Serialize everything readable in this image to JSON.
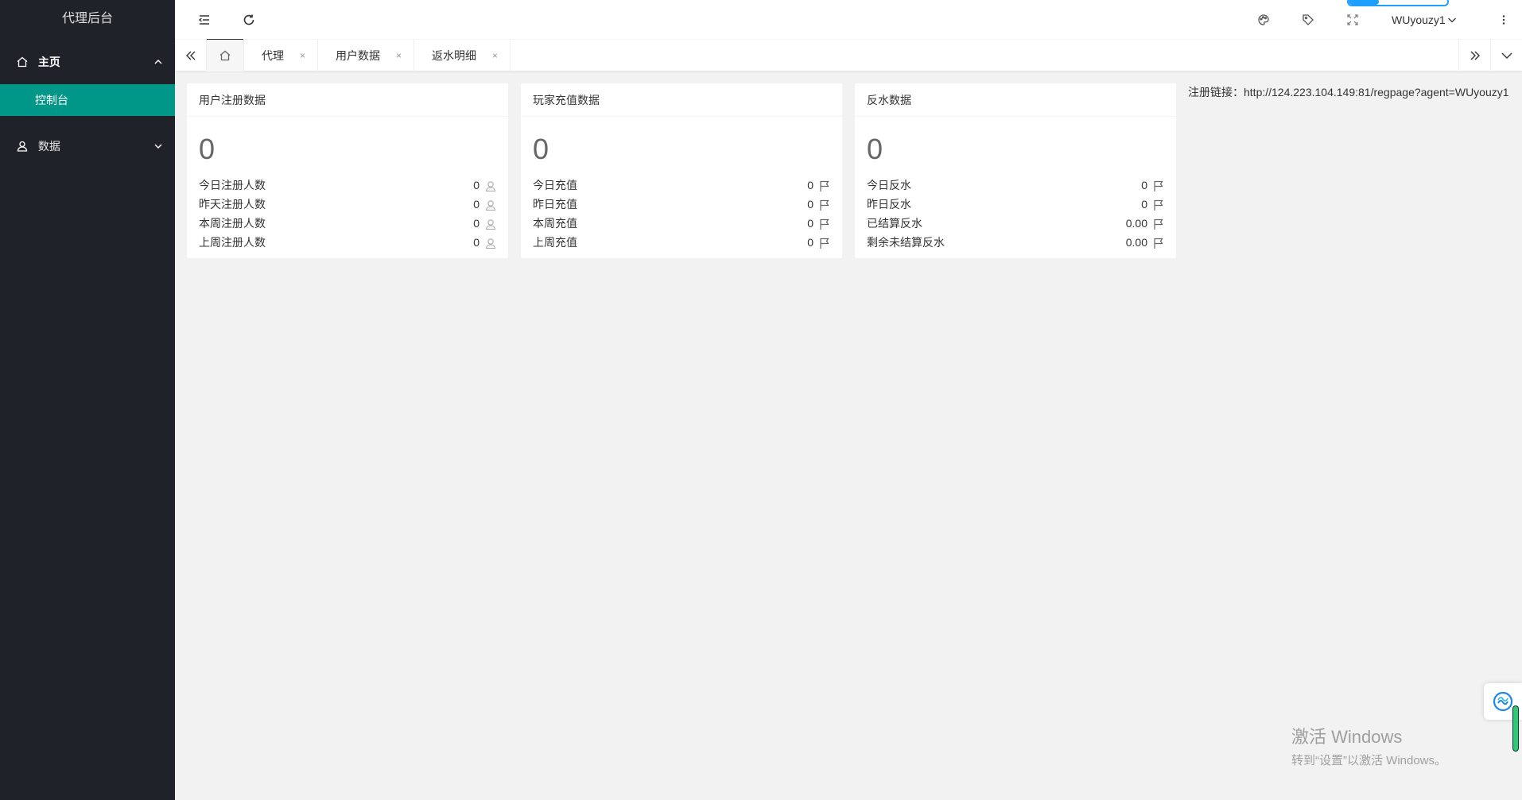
{
  "sidebar": {
    "logo": "代理后台",
    "groups": [
      {
        "label": "主页",
        "icon": "home-icon",
        "expanded": true,
        "children": [
          "控制台"
        ]
      },
      {
        "label": "数据",
        "icon": "user-icon",
        "expanded": false
      }
    ]
  },
  "header": {
    "user": "WUyouzy1"
  },
  "tabs": {
    "items": [
      {
        "label": "代理"
      },
      {
        "label": "用户数据"
      },
      {
        "label": "返水明细"
      }
    ],
    "close_glyph": "×"
  },
  "cards": [
    {
      "title": "用户注册数据",
      "total": "0",
      "row_icon": "user-outline-icon",
      "rows": [
        {
          "label": "今日注册人数",
          "value": "0"
        },
        {
          "label": "昨天注册人数",
          "value": "0"
        },
        {
          "label": "本周注册人数",
          "value": "0"
        },
        {
          "label": "上周注册人数",
          "value": "0"
        }
      ]
    },
    {
      "title": "玩家充值数据",
      "total": "0",
      "row_icon": "flag-icon",
      "rows": [
        {
          "label": "今日充值",
          "value": "0"
        },
        {
          "label": "昨日充值",
          "value": "0"
        },
        {
          "label": "本周充值",
          "value": "0"
        },
        {
          "label": "上周充值",
          "value": "0"
        }
      ]
    },
    {
      "title": "反水数据",
      "total": "0",
      "row_icon": "flag-icon",
      "rows": [
        {
          "label": "今日反水",
          "value": "0"
        },
        {
          "label": "昨日反水",
          "value": "0"
        },
        {
          "label": "已结算反水",
          "value": "0.00"
        },
        {
          "label": "剩余未结算反水",
          "value": "0.00"
        }
      ]
    }
  ],
  "reg_link": {
    "label": "注册链接：",
    "url": "http://124.223.104.149:81/regpage?agent=WUyouzy1"
  },
  "watermark": {
    "line1": "激活 Windows",
    "line2": "转到“设置”以激活 Windows。"
  },
  "colors": {
    "sidebar_bg": "#20222a",
    "accent": "#009688",
    "page_bg": "#f2f2f2"
  }
}
